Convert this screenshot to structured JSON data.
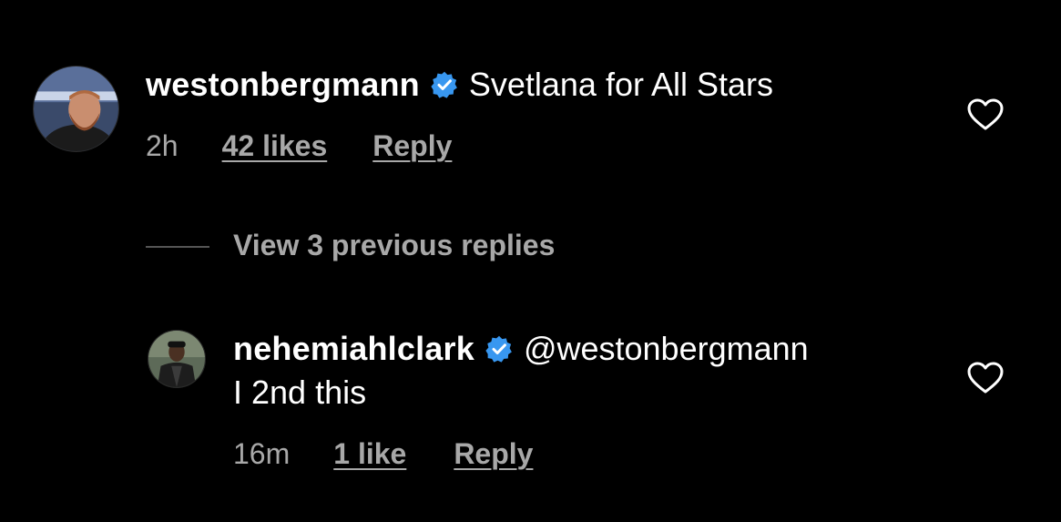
{
  "comment": {
    "username": "westonbergmann",
    "text": "Svetlana for All Stars",
    "time": "2h",
    "likes": "42 likes",
    "reply_label": "Reply"
  },
  "view_replies": {
    "label": "View 3 previous replies"
  },
  "reply": {
    "username": "nehemiahlclark",
    "mention": "@westonbergmann",
    "text": "I 2nd this",
    "time": "16m",
    "likes": "1 like",
    "reply_label": "Reply"
  },
  "colors": {
    "background": "#000000",
    "text": "#ffffff",
    "muted": "#a8a8a8",
    "verified": "#3897f0"
  },
  "icons": {
    "verified": "verified-badge-icon",
    "like": "heart-outline-icon"
  }
}
